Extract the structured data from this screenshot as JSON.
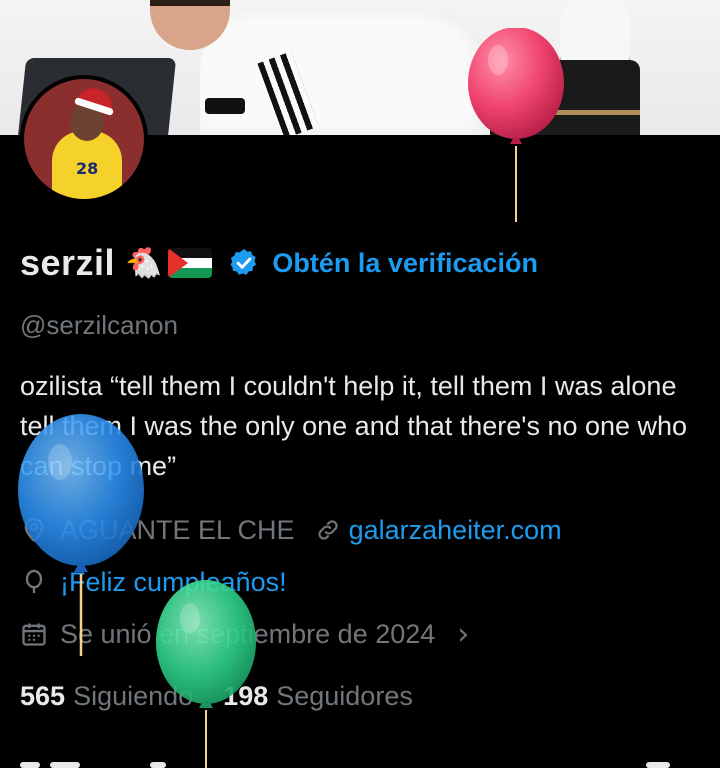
{
  "profile": {
    "display_name": "serzil",
    "name_emoji": "🐔",
    "verify_link": "Obtén la verificación",
    "handle": "@serzilcanon",
    "bio": "ozilista “tell them I couldn't help it, tell them I was alone tell them I was the only one and that there's no one who can stop me”",
    "location": "AGUANTE EL CHE",
    "website": "galarzaheiter.com",
    "birthday": "¡Feliz cumpleaños!",
    "joined": "Se unió en septiembre de 2024",
    "joined_chevron": "›",
    "following_count": "565",
    "following_label": "Siguiendo",
    "followers_count": "198",
    "followers_label": "Seguidores"
  },
  "icons": {
    "verified": "verified-badge-icon",
    "location": "location-pin-icon",
    "link": "link-icon",
    "birthday": "balloon-icon",
    "calendar": "calendar-icon"
  },
  "colors": {
    "background": "#000000",
    "text": "#e7e9ea",
    "secondary": "#71767b",
    "accent": "#1d9bf0",
    "balloon_pink": "#f0456e",
    "balloon_blue": "#2b8ff0",
    "balloon_green": "#2fd38a"
  }
}
